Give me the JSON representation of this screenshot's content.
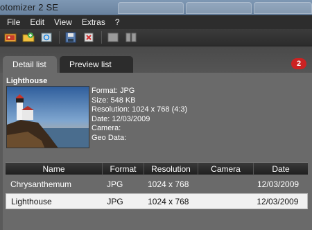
{
  "window": {
    "title": "otomizer 2 SE"
  },
  "menu": [
    "File",
    "Edit",
    "View",
    "Extras",
    "?"
  ],
  "toolbar": {
    "icons": [
      "open-folder-icon",
      "add-folder-icon",
      "refresh-icon",
      "save-icon",
      "delete-icon",
      "view-single-icon",
      "view-split-icon"
    ]
  },
  "tabs": [
    {
      "label": "Detail list",
      "active": true
    },
    {
      "label": "Preview list",
      "active": false
    }
  ],
  "badge": "2",
  "detail": {
    "name": "Lighthouse",
    "format": "Format: JPG",
    "size": "Size: 548 KB",
    "resolution": "Resolution: 1024 x 768 (4:3)",
    "date": "Date: 12/03/2009",
    "camera": "Camera:",
    "geo": "Geo Data:"
  },
  "table": {
    "columns": [
      "Name",
      "Format",
      "Resolution",
      "Camera",
      "Date"
    ],
    "rows": [
      {
        "name": "Chrysanthemum",
        "format": "JPG",
        "resolution": "1024 x 768",
        "camera": "",
        "date": "12/03/2009",
        "selected": false
      },
      {
        "name": "Lighthouse",
        "format": "JPG",
        "resolution": "1024 x 768",
        "camera": "",
        "date": "12/03/2009",
        "selected": true
      }
    ]
  },
  "colors": {
    "accent_badge": "#cc2222",
    "panel": "#6a6a6a",
    "background": "#5a5a5a"
  }
}
